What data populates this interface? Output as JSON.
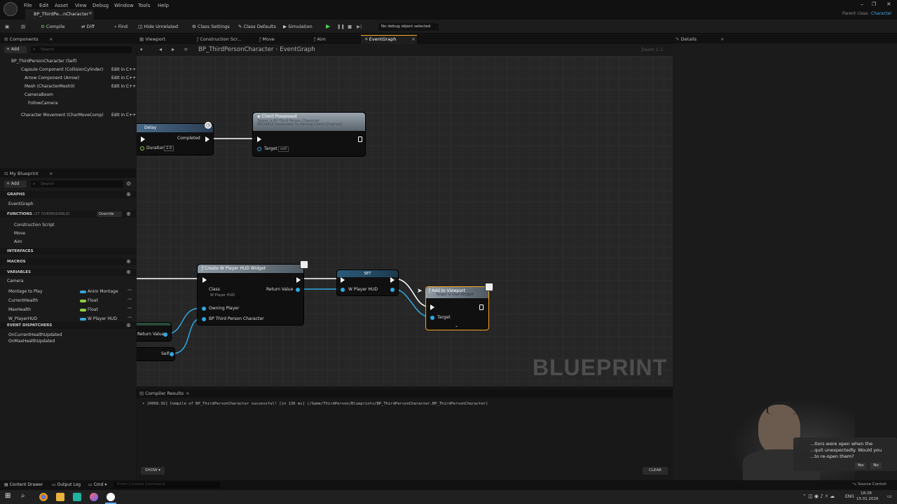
{
  "app": {
    "logo": "unreal-logo",
    "menu": [
      "File",
      "Edit",
      "Asset",
      "View",
      "Debug",
      "Window",
      "Tools",
      "Help"
    ],
    "doc_tab": "BP_ThirdPe...nCharacter",
    "parent_class_label": "Parent class:",
    "parent_class": "Character"
  },
  "toolbar": {
    "compile": "Compile",
    "diff": "Diff",
    "find": "Find",
    "hide_unrelated": "Hide Unrelated",
    "class_settings": "Class Settings",
    "class_defaults": "Class Defaults",
    "simulation": "Simulation",
    "debug_object": "No debug object selected"
  },
  "components": {
    "tab": "Components",
    "add": "+ Add",
    "search_placeholder": "Search",
    "items": [
      {
        "label": "BP_ThirdPersonCharacter (Self)",
        "link": ""
      },
      {
        "label": "Capsule Component (CollisionCylinder)",
        "link": "Edit in C++"
      },
      {
        "label": "Arrow Component (Arrow)",
        "link": "Edit in C++"
      },
      {
        "label": "Mesh (CharacterMesh0)",
        "link": "Edit in C++"
      },
      {
        "label": "CameraBoom",
        "link": ""
      },
      {
        "label": "FollowCamera",
        "link": ""
      },
      {
        "label": "Character Movement (CharMoveComp)",
        "link": "Edit in C++"
      }
    ]
  },
  "my_blueprint": {
    "tab": "My Blueprint",
    "add": "+ Add",
    "search_placeholder": "Search",
    "graphs_header": "GRAPHS",
    "event_graph": "EventGraph",
    "functions_header": "FUNCTIONS",
    "functions_count": "(37 OVERRIDABLE)",
    "override": "Override",
    "functions": [
      "Construction Script",
      "Move",
      "Aim"
    ],
    "interfaces_header": "INTERFACES",
    "macros_header": "MACROS",
    "variables_header": "VARIABLES",
    "camera_category": "Camera",
    "variables": [
      {
        "name": "Montage to Play",
        "type": "Anim Montage",
        "color": "#3aa6d8"
      },
      {
        "name": "CurrentHealth",
        "type": "Float",
        "color": "#8fd142"
      },
      {
        "name": "MaxHealth",
        "type": "Float",
        "color": "#8fd142"
      },
      {
        "name": "W_PlayerHUD",
        "type": "W Player HUD",
        "color": "#3aa6d8"
      }
    ],
    "dispatchers_header": "EVENT DISPATCHERS",
    "dispatchers": [
      "OnCurrentHealthUpdated",
      "OnMaxHealthUpdated"
    ]
  },
  "graph_tabs": [
    "Viewport",
    "Construction Scr...",
    "Move",
    "Aim",
    "EventGraph"
  ],
  "breadcrumb": {
    "root": "BP_ThirdPersonCharacter",
    "child": "EventGraph"
  },
  "zoom": "Zoom 1:1",
  "watermark": "BLUEPRINT",
  "nodes": {
    "delay": {
      "title": "Delay",
      "completed": "Completed",
      "duration": "Duration",
      "duration_value": "2.0"
    },
    "client": {
      "title": "Client Possessed",
      "sub": "Target is BP Third Person Character",
      "sub2": "RELIABLE Replicated To Owning Client (if server)",
      "target": "Target",
      "self": "self"
    },
    "create": {
      "title": "Create W Player HUD Widget",
      "class": "Class",
      "class_value": "W Player HUD",
      "return_value": "Return Value",
      "owning_player": "Owning Player",
      "bp": "BP Third Person Character"
    },
    "set": {
      "title": "SET",
      "pin": "W Player HUD"
    },
    "add": {
      "title": "Add to Viewport",
      "sub": "Target is User Widget",
      "target": "Target"
    },
    "return_value": "Return Value",
    "self": "Self"
  },
  "compiler": {
    "tab": "Compiler Results",
    "message": "[0068.92] Compile of BP_ThirdPersonCharacter successful! [in 136 ms] (/Game/ThirdPerson/Blueprints/BP_ThirdPersonCharacter.BP_ThirdPersonCharacter)",
    "show": "SHOW",
    "clear": "CLEAR"
  },
  "details": {
    "tab": "Details"
  },
  "notification": {
    "text1": "...itors were open when the",
    "text2": "...quit unexpectedly. Would you",
    "text3": "...to re-open them?",
    "yes": "Yes",
    "no": "No"
  },
  "status": {
    "content_drawer": "Content Drawer",
    "output_log": "Output Log",
    "cmd": "Cmd",
    "console_placeholder": "Enter Console Command",
    "source_control": "Source Control"
  },
  "taskbar": {
    "lang": "ENG",
    "time": "18:28",
    "date": "15.01.2026"
  },
  "colors": {
    "accent": "#f5a623",
    "exec_wire": "#ffffff",
    "object_pin": "#2fa8e0",
    "selected_border": "#f5a623"
  }
}
